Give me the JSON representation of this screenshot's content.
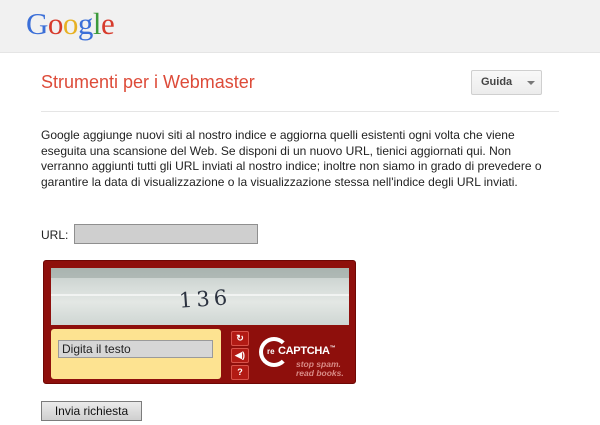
{
  "header": {
    "logo_letters": [
      "G",
      "o",
      "o",
      "g",
      "l",
      "e"
    ]
  },
  "page": {
    "title": "Strumenti per i Webmaster",
    "help_label": "Guida",
    "description": "Google aggiunge nuovi siti al nostro indice e aggiorna quelli esistenti ogni volta che viene eseguita una scansione del Web. Se disponi di un nuovo URL, tienici aggiornati qui. Non verranno aggiunti tutti gli URL inviati al nostro indice; inoltre non siamo in grado di prevedere o garantire la data di visualizzazione o la visualizzazione stessa nell'indice degli URL inviati."
  },
  "form": {
    "url_label": "URL:",
    "url_value": "",
    "submit_label": "Invia richiesta"
  },
  "captcha": {
    "challenge_text": "136",
    "input_placeholder": "Digita il testo",
    "buttons": [
      {
        "icon": "refresh-icon",
        "glyph": "↻"
      },
      {
        "icon": "audio-icon",
        "glyph": "◀)"
      },
      {
        "icon": "help-icon",
        "glyph": "?"
      }
    ],
    "brand_re": "re",
    "brand_name": "CAPTCHA",
    "brand_tm": "™",
    "tagline_1": "stop spam.",
    "tagline_2": "read books."
  },
  "colors": {
    "title_red": "#dd4b39",
    "captcha_red": "#8e0f0c",
    "captcha_yellow": "#fde391"
  }
}
